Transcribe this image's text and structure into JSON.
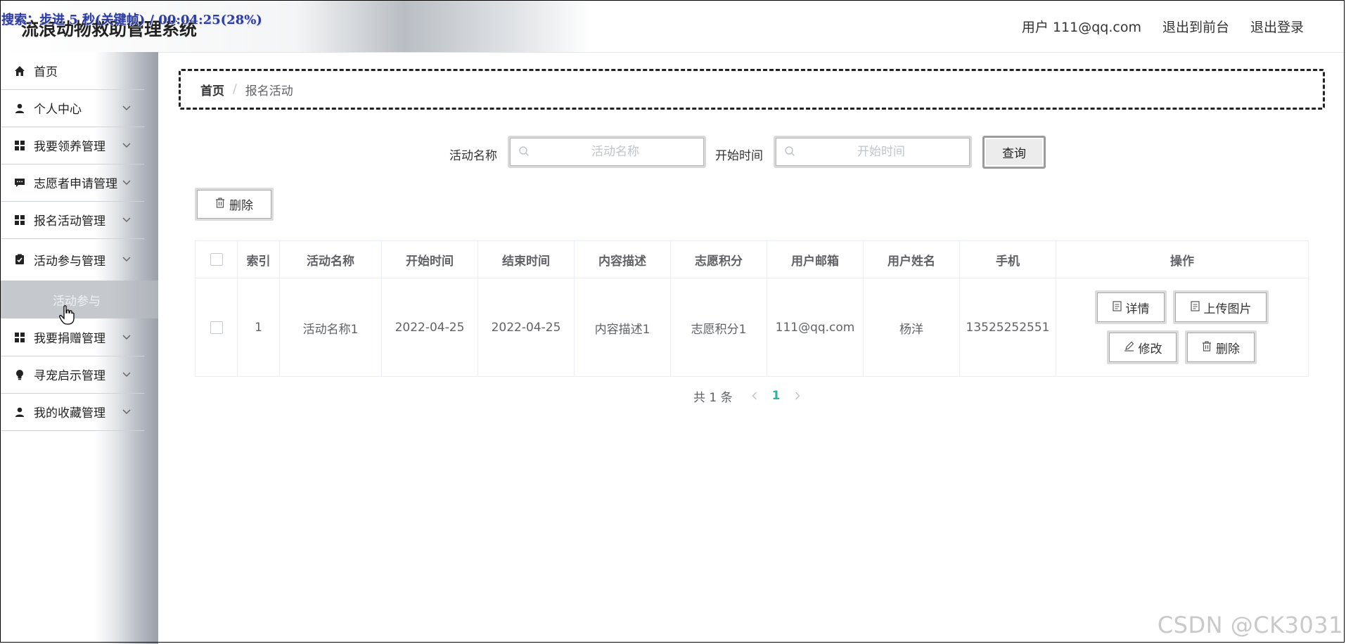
{
  "overlay": {
    "text": "搜索：步进 5 秒(关键帧) / 00:04:25(28%)"
  },
  "header": {
    "title": "流浪动物救助管理系统",
    "user": "用户 111@qq.com",
    "to_front": "退出到前台",
    "logout": "退出登录"
  },
  "sidebar": {
    "items": [
      {
        "label": "首页",
        "icon": "home-icon"
      },
      {
        "label": "个人中心",
        "icon": "user-icon"
      },
      {
        "label": "我要领养管理",
        "icon": "grid-icon"
      },
      {
        "label": "志愿者申请管理",
        "icon": "chat-icon"
      },
      {
        "label": "报名活动管理",
        "icon": "grid-icon"
      },
      {
        "label": "活动参与管理",
        "icon": "clipboard-icon"
      },
      {
        "label": "我要捐赠管理",
        "icon": "grid-icon"
      },
      {
        "label": "寻宠启示管理",
        "icon": "bulb-icon"
      },
      {
        "label": "我的收藏管理",
        "icon": "user-icon"
      }
    ],
    "submenu": {
      "label": "活动参与"
    }
  },
  "breadcrumb": {
    "home": "首页",
    "separator": "/",
    "current": "报名活动"
  },
  "search": {
    "name_label": "活动名称",
    "name_placeholder": "活动名称",
    "name_value": "",
    "start_label": "开始时间",
    "start_placeholder": "开始时间",
    "start_value": "",
    "query_button": "查询"
  },
  "toolbar": {
    "delete_label": "删除"
  },
  "table": {
    "headers": [
      "索引",
      "活动名称",
      "开始时间",
      "结束时间",
      "内容描述",
      "志愿积分",
      "用户邮箱",
      "用户姓名",
      "手机",
      "操作"
    ],
    "rows": [
      {
        "index": "1",
        "name": "活动名称1",
        "start": "2022-04-25",
        "end": "2022-04-25",
        "desc": "内容描述1",
        "points": "志愿积分1",
        "email": "111@qq.com",
        "username": "杨洋",
        "phone": "13525252551",
        "actions": {
          "detail": "详情",
          "upload": "上传图片",
          "edit": "修改",
          "delete": "删除"
        }
      }
    ]
  },
  "pagination": {
    "total": "共 1 条",
    "current_page": "1"
  },
  "watermark": "CSDN @CK3031",
  "colors": {
    "accent": "#2bb39a",
    "border": "#ebeef5",
    "text": "#606266"
  }
}
